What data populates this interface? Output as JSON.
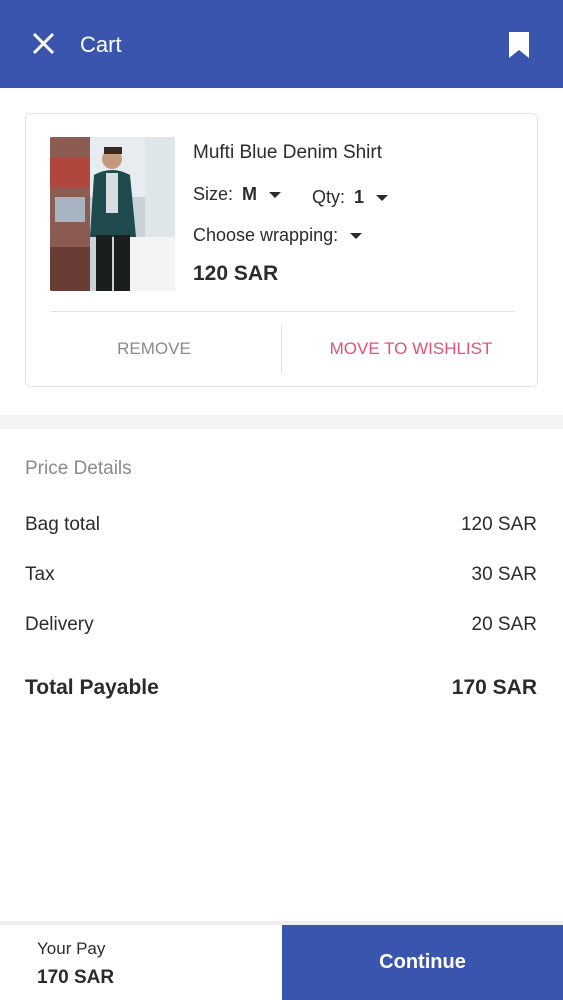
{
  "header": {
    "title": "Cart",
    "close_icon": "close-icon",
    "bookmark_icon": "bookmark-icon",
    "background": "#3a55ad"
  },
  "cart_item": {
    "name": "Mufti Blue Denim Shirt",
    "size_label": "Size:",
    "size_value": "M",
    "qty_label": "Qty:",
    "qty_value": "1",
    "wrapping_label": "Choose wrapping:",
    "price": "120 SAR",
    "remove_label": "REMOVE",
    "wishlist_label": "MOVE TO WISHLIST"
  },
  "price_details": {
    "heading": "Price Details",
    "rows": [
      {
        "label": "Bag total",
        "value": "120 SAR"
      },
      {
        "label": "Tax",
        "value": "30 SAR"
      },
      {
        "label": "Delivery",
        "value": "20 SAR"
      }
    ],
    "total": {
      "label": "Total Payable",
      "value": "170 SAR"
    }
  },
  "footer": {
    "your_pay_label": "Your Pay",
    "your_pay_value": "170 SAR",
    "continue_label": "Continue"
  },
  "colors": {
    "primary": "#3a55ad",
    "wishlist": "#e0527a",
    "muted": "#8a8a8a"
  }
}
